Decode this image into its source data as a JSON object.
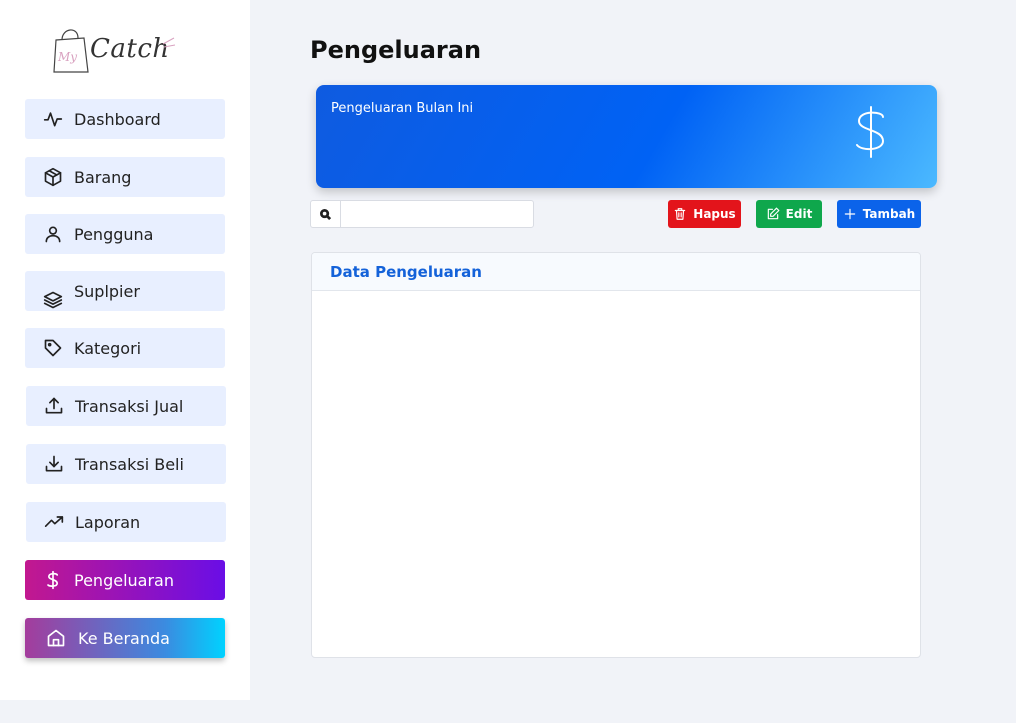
{
  "logo": {
    "text": "Catch",
    "prefix": "My"
  },
  "sidebar": {
    "items": [
      {
        "label": "Dashboard",
        "icon": "activity-icon"
      },
      {
        "label": "Barang",
        "icon": "box-icon"
      },
      {
        "label": "Pengguna",
        "icon": "user-icon"
      },
      {
        "label": "Suplpier",
        "icon": "layers-icon"
      },
      {
        "label": "Kategori",
        "icon": "tag-icon"
      },
      {
        "label": "Transaksi Jual",
        "icon": "upload-icon"
      },
      {
        "label": "Transaksi Beli",
        "icon": "download-icon"
      },
      {
        "label": "Laporan",
        "icon": "trending-up-icon"
      },
      {
        "label": "Pengeluaran",
        "icon": "dollar-icon",
        "active": true
      },
      {
        "label": "Ke Beranda",
        "icon": "home-icon"
      }
    ]
  },
  "page": {
    "title": "Pengeluaran"
  },
  "summary": {
    "label": "Pengeluaran Bulan Ini",
    "value": ""
  },
  "search": {
    "value": "",
    "placeholder": ""
  },
  "toolbar": {
    "hapus_label": "Hapus",
    "edit_label": "Edit",
    "tambah_label": "Tambah"
  },
  "table": {
    "title": "Data Pengeluaran",
    "rows": []
  },
  "colors": {
    "active_start": "#c2188f",
    "active_end": "#6a0ee6",
    "card_blue": "#0062f5",
    "hapus": "#e3141b",
    "edit": "#0fa74c",
    "tambah": "#0b63ea"
  }
}
